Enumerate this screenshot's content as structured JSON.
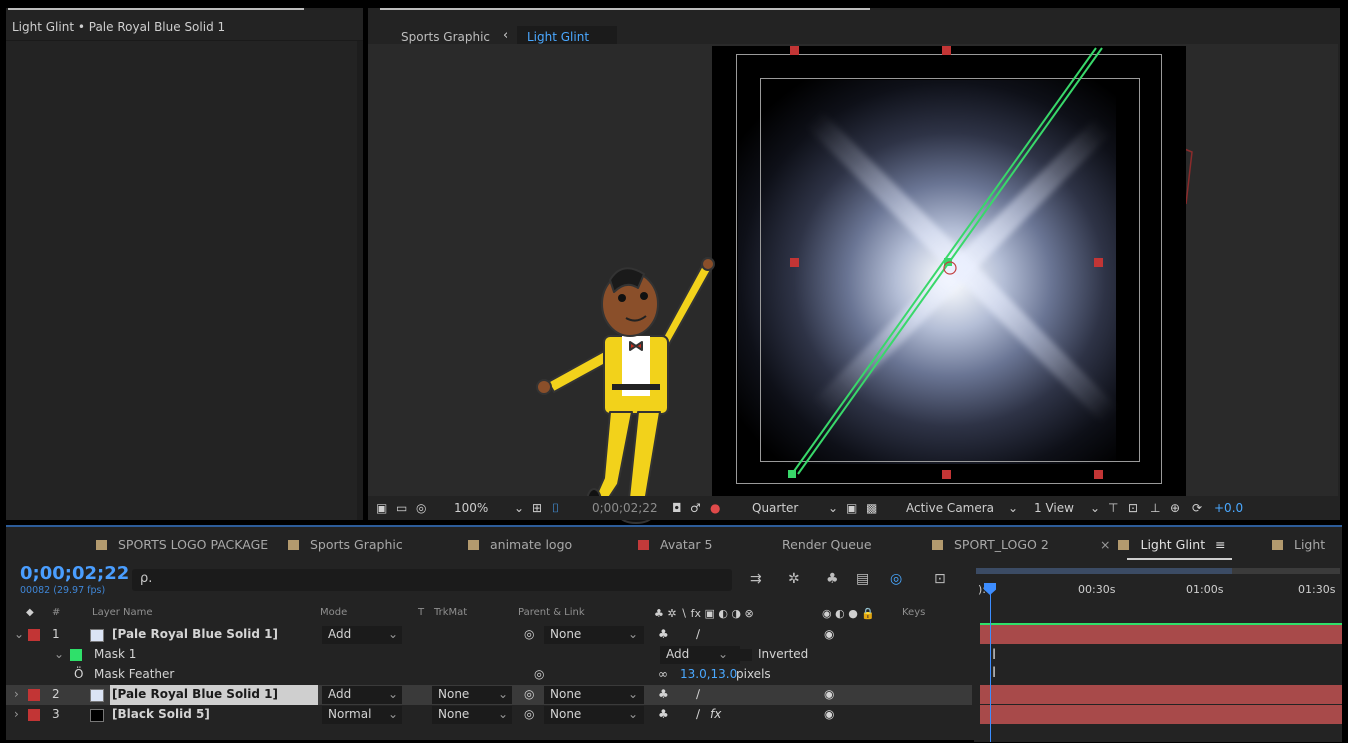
{
  "left_panel": {
    "title": "Light Glint • Pale Royal Blue Solid 1"
  },
  "composition": {
    "tabs": {
      "parent": "Sports Graphic",
      "back_arrow": "‹",
      "active": "Light Glint"
    },
    "toolbar": {
      "zoom": "100%",
      "timecode": "0;00;02;22",
      "resolution": "Quarter",
      "camera": "Active Camera",
      "view": "1 View",
      "exposure": "+0.0"
    }
  },
  "timeline": {
    "tabs": [
      {
        "label": "SPORTS LOGO PACKAGE",
        "color": "#b39a6e"
      },
      {
        "label": "Sports Graphic",
        "color": "#b39a6e"
      },
      {
        "label": "animate logo",
        "color": "#b39a6e"
      },
      {
        "label": "Avatar 5",
        "color": "#c23a3a"
      },
      {
        "label": "Render Queue",
        "color": ""
      },
      {
        "label": "SPORT_LOGO 2",
        "color": "#b39a6e"
      },
      {
        "label": "Light Glint",
        "color": "#b39a6e",
        "close": "×",
        "menu": "≡"
      },
      {
        "label": "Light",
        "color": "#b39a6e"
      }
    ],
    "current_time": "0;00;02;22",
    "frames_info": "00082 (29.97 fps)",
    "search_icon": "ρ.",
    "ruler_labels": [
      "00:30s",
      "01:00s",
      "01:30s"
    ],
    "ruler_start": "):0",
    "columns": {
      "layer_name": "Layer Name",
      "mode": "Mode",
      "t": "T",
      "trkmat": "TrkMat",
      "parent": "Parent & Link",
      "keys": "Keys",
      "hash": "#"
    },
    "layers": [
      {
        "num": "1",
        "name": "[Pale Royal Blue Solid 1]",
        "mode": "Add",
        "trkmat": "",
        "parent": "None",
        "label_color": "#c23535",
        "swatch": "#dbe4f5",
        "fx": ""
      },
      {
        "num": "2",
        "name": "[Pale Royal Blue Solid 1]",
        "mode": "Add",
        "trkmat": "None",
        "parent": "None",
        "label_color": "#c23535",
        "swatch": "#dbe4f5",
        "fx": ""
      },
      {
        "num": "3",
        "name": "[Black Solid 5]",
        "mode": "Normal",
        "trkmat": "None",
        "parent": "None",
        "label_color": "#c23535",
        "swatch": "#000000",
        "fx": "fx"
      }
    ],
    "mask": {
      "name": "Mask 1",
      "mode": "Add",
      "inverted_label": "Inverted",
      "color": "#2fe06a",
      "feather_label": "Mask Feather",
      "feather_value": "13.0,13.0",
      "feather_unit": "pixels"
    }
  }
}
